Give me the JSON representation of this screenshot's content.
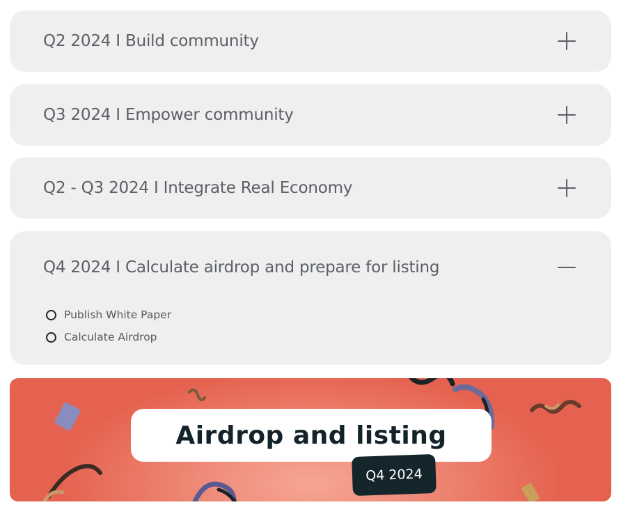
{
  "roadmap": {
    "items": [
      {
        "title": "Q2 2024 I Build community",
        "expanded": false
      },
      {
        "title": "Q3 2024 I Empower community",
        "expanded": false
      },
      {
        "title": "Q2 - Q3 2024 I Integrate Real Economy",
        "expanded": false
      },
      {
        "title": "Q4 2024 I Calculate airdrop and prepare for listing",
        "expanded": true,
        "subitems": [
          "Publish White Paper",
          "Calculate Airdrop"
        ]
      }
    ]
  },
  "banner": {
    "headline": "Airdrop and listing",
    "tag": "Q4 2024",
    "background_color": "#e56250",
    "dark_color": "#14262c"
  },
  "icons": {
    "collapsed": "plus-icon",
    "expanded": "minus-icon",
    "subitem": "circle-outline-icon"
  }
}
